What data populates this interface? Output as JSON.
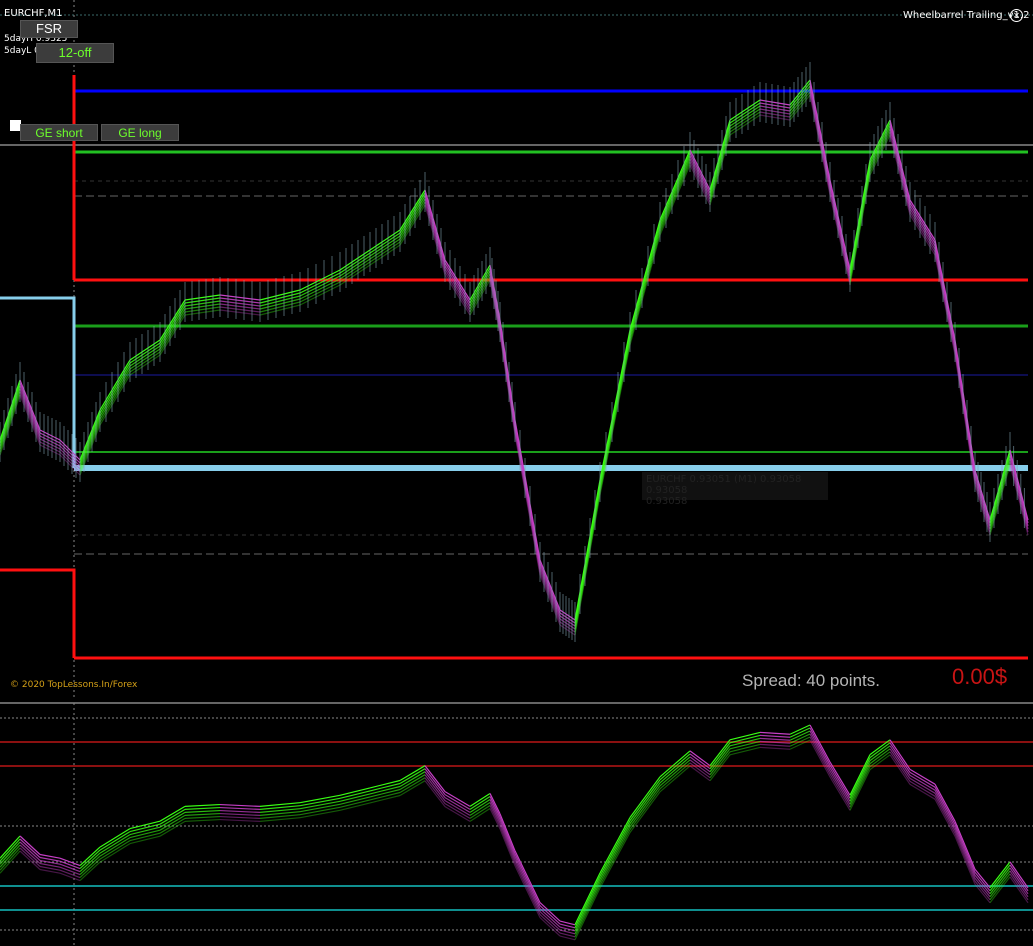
{
  "chart": {
    "symbol_timeframe": "EURCHF,M1",
    "fivedayH_label": "5dayH 0.9325",
    "fivedayL_label": "5dayL 0.9284",
    "indicator_name": "Wheelbarrel Trailing_v1.2",
    "copyright": "© 2020 TopLessons.In/Forex",
    "spread_text": "Spread: 40 points.",
    "profit_text": "0.00$",
    "tooltip_line1": "EURCHF 0.93051 (M1) 0.93058 0.93058",
    "tooltip_line2": "0.93058"
  },
  "buttons": {
    "fsr": "FSR",
    "off": "12-off",
    "ge_short": "GE short",
    "ge_long": "GE long"
  },
  "colors": {
    "background": "#000000",
    "bull": "#39ff14",
    "bear": "#c63fc6",
    "resistance": "#ff1010",
    "support_blue": "#0000ff",
    "green_line": "#1a9e1a",
    "light_blue": "#87ceeb",
    "spread_gray": "#b4b4b4",
    "profit_red": "#c81414",
    "copyright_gold": "#d4a017",
    "teal": "#0f8f8f",
    "dark_red": "#8b1010"
  }
}
